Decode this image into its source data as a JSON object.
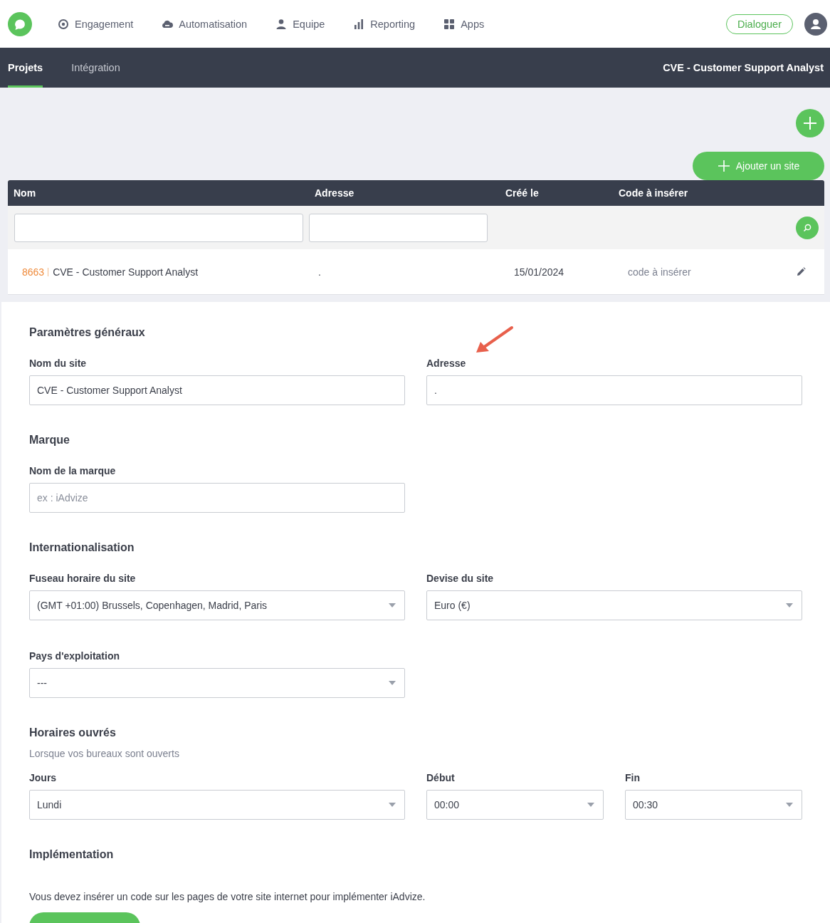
{
  "nav": {
    "items": [
      {
        "label": "Engagement"
      },
      {
        "label": "Automatisation"
      },
      {
        "label": "Equipe"
      },
      {
        "label": "Reporting"
      },
      {
        "label": "Apps"
      }
    ],
    "dialog_button": "Dialoguer"
  },
  "subnav": {
    "tabs": [
      {
        "label": "Projets",
        "selected": true
      },
      {
        "label": "Intégration",
        "selected": false
      }
    ],
    "project_title": "CVE - Customer Support Analyst"
  },
  "add_site_button": "Ajouter un site",
  "table": {
    "columns": [
      "Nom",
      "Adresse",
      "Créé le",
      "Code à insérer"
    ],
    "rows": [
      {
        "id": "8663",
        "name": "CVE - Customer Support Analyst",
        "address": ".",
        "created": "15/01/2024",
        "code": "code à insérer"
      }
    ]
  },
  "sections": [
    {
      "title": "Paramètres généraux",
      "rows": [
        [
          {
            "label": "Nom du site",
            "kind": "text",
            "value": "CVE - Customer Support Analyst"
          },
          {
            "label": "Adresse",
            "kind": "text",
            "value": "."
          }
        ]
      ]
    },
    {
      "title": "Marque",
      "rows": [
        [
          {
            "label": "Nom de la marque",
            "kind": "text",
            "placeholder": "ex : iAdvize"
          }
        ]
      ]
    },
    {
      "title": "Internationalisation",
      "rows": [
        [
          {
            "label": "Fuseau horaire du site",
            "kind": "select",
            "value": "(GMT +01:00) Brussels, Copenhagen, Madrid, Paris"
          },
          {
            "label": "Devise du site",
            "kind": "select",
            "value": "Euro (€)"
          }
        ],
        [
          {
            "label": "Pays d'exploitation",
            "kind": "select",
            "value": "---"
          }
        ]
      ]
    },
    {
      "title": "Horaires ouvrés",
      "subtitle": "Lorsque vos bureaux sont ouverts",
      "rows": [
        [
          {
            "label": "Jours",
            "kind": "select",
            "value": "Lundi"
          },
          {
            "label": "Début",
            "kind": "select",
            "value": "00:00"
          },
          {
            "label": "Fin",
            "kind": "select",
            "value": "00:30"
          }
        ]
      ]
    },
    {
      "title": "Implémentation",
      "text": "Vous devez insérer un code sur les pages de votre site internet pour implémenter iAdvize."
    }
  ]
}
